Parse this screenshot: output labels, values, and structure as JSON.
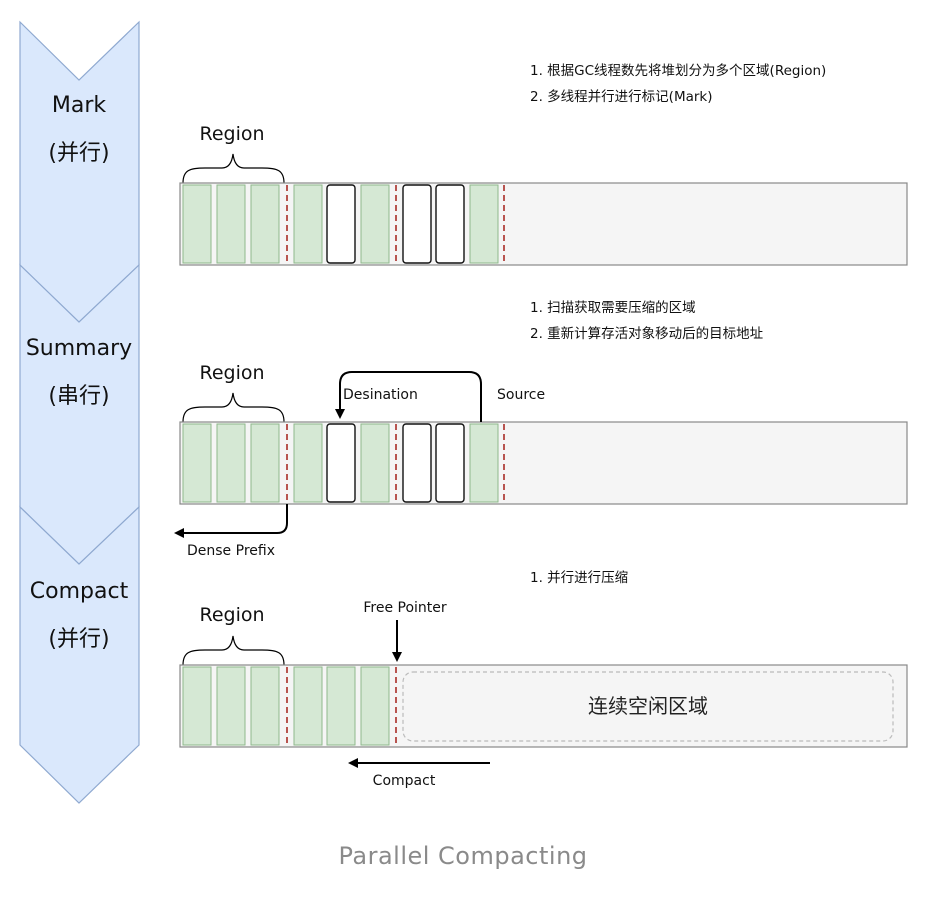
{
  "phases": [
    {
      "name": "Mark",
      "mode": "(并行)"
    },
    {
      "name": "Summary",
      "mode": "(串行)"
    },
    {
      "name": "Compact",
      "mode": "(并行)"
    }
  ],
  "mark": {
    "notes": [
      "1. 根据GC线程数先将堆划分为多个区域(Region)",
      "2. 多线程并行进行标记(Mark)"
    ],
    "region_label": "Region"
  },
  "summary": {
    "notes": [
      "1. 扫描获取需要压缩的区域",
      "2. 重新计算存活对象移动后的目标地址"
    ],
    "region_label": "Region",
    "destination_label": "Desination",
    "source_label": "Source",
    "dense_prefix_label": "Dense Prefix"
  },
  "compact": {
    "notes": [
      "1. 并行进行压缩"
    ],
    "region_label": "Region",
    "free_pointer_label": "Free Pointer",
    "free_area_label": "连续空闲区域",
    "compact_label": "Compact"
  },
  "caption": "Parallel Compacting",
  "colors": {
    "chevron_fill": "#dae8fc",
    "chevron_stroke": "#8fa9d0",
    "live_fill": "#d5e8d4",
    "live_stroke": "#8fb98c",
    "divider": "#b85450",
    "heap_fill": "#f5f5f5",
    "heap_stroke": "#888888"
  }
}
